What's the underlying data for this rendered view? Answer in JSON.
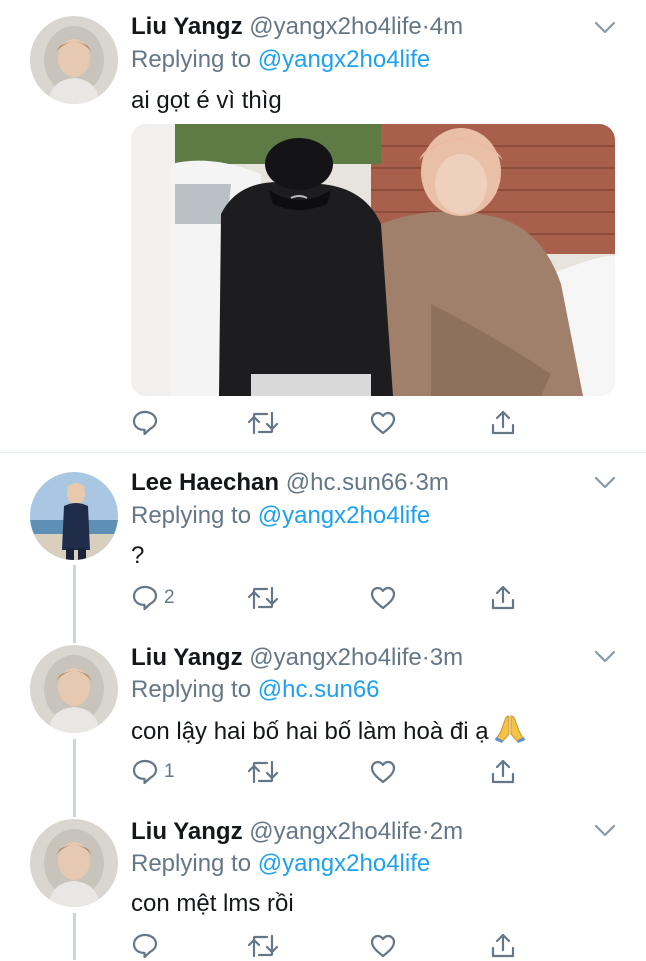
{
  "tweets": [
    {
      "name": "Liu Yangz",
      "handle": "@yangx2ho4life",
      "dot": "·",
      "time": "4m",
      "replying_prefix": "Replying to ",
      "replying_to": "@yangx2ho4life",
      "text": "ai gọt é vì thìg",
      "has_media": true,
      "reply_count": "",
      "retweet_count": "",
      "like_count": ""
    },
    {
      "name": "Lee Haechan",
      "handle": "@hc.sun66",
      "dot": "·",
      "time": "3m",
      "replying_prefix": "Replying to ",
      "replying_to": "@yangx2ho4life",
      "text": "?",
      "reply_count": "2",
      "retweet_count": "",
      "like_count": ""
    },
    {
      "name": "Liu Yangz",
      "handle": "@yangx2ho4life",
      "dot": "·",
      "time": "3m",
      "replying_prefix": "Replying to ",
      "replying_to": "@hc.sun66",
      "text": "con lậy hai bố hai bố làm hoà đi ạ",
      "emoji": "folded-hands",
      "reply_count": "1",
      "retweet_count": "",
      "like_count": ""
    },
    {
      "name": "Liu Yangz",
      "handle": "@yangx2ho4life",
      "dot": "·",
      "time": "2m",
      "replying_prefix": "Replying to ",
      "replying_to": "@yangx2ho4life",
      "text": "con mệt lms rồi",
      "reply_count": "",
      "retweet_count": "",
      "like_count": ""
    }
  ],
  "colors": {
    "text": "#14171a",
    "secondary": "#657786",
    "accent": "#1da1f2",
    "thread_line": "#ccd6dd",
    "separator": "#e6ecf0"
  },
  "icons": [
    "reply-icon",
    "retweet-icon",
    "like-icon",
    "share-icon",
    "chevron-down-icon"
  ]
}
